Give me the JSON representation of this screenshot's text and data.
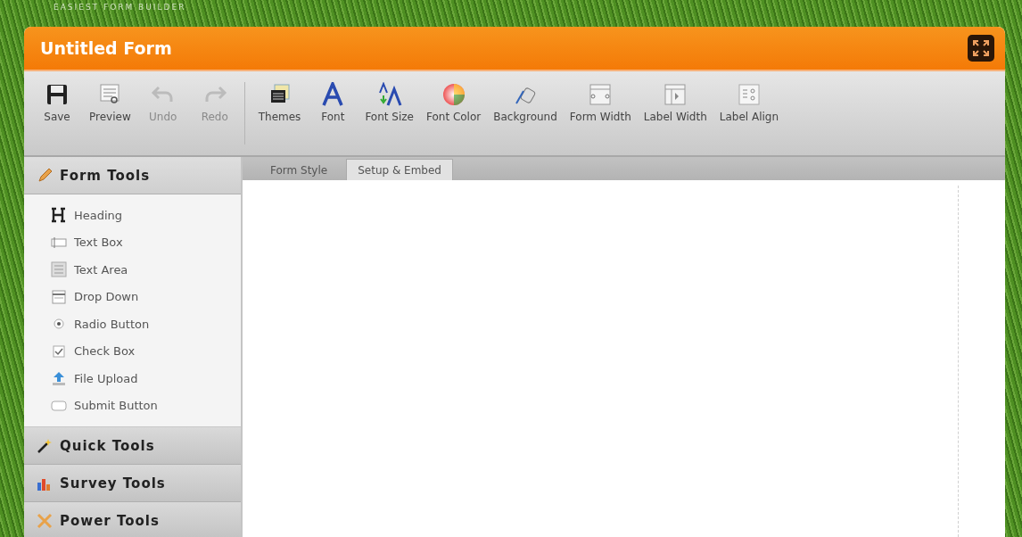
{
  "brand": {
    "tagline": "EASIEST FORM BUILDER"
  },
  "window": {
    "title": "Untitled Form"
  },
  "toolbar": {
    "groups": [
      [
        {
          "label": "Save",
          "disabled": false
        },
        {
          "label": "Preview",
          "disabled": false
        },
        {
          "label": "Undo",
          "disabled": true
        },
        {
          "label": "Redo",
          "disabled": true
        }
      ],
      [
        {
          "label": "Themes",
          "disabled": false
        },
        {
          "label": "Font",
          "disabled": false
        },
        {
          "label": "Font Size",
          "disabled": false
        },
        {
          "label": "Font Color",
          "disabled": false
        },
        {
          "label": "Background",
          "disabled": false
        },
        {
          "label": "Form Width",
          "disabled": false
        },
        {
          "label": "Label Width",
          "disabled": false
        },
        {
          "label": "Label Align",
          "disabled": false
        }
      ]
    ]
  },
  "sidebar": {
    "sections": [
      {
        "title": "Form Tools",
        "expanded": true,
        "items": [
          "Heading",
          "Text Box",
          "Text Area",
          "Drop Down",
          "Radio Button",
          "Check Box",
          "File Upload",
          "Submit Button"
        ]
      },
      {
        "title": "Quick Tools",
        "expanded": false
      },
      {
        "title": "Survey Tools",
        "expanded": false
      },
      {
        "title": "Power Tools",
        "expanded": false
      }
    ]
  },
  "tabs": [
    {
      "label": "Form Style",
      "selected": false
    },
    {
      "label": "Setup & Embed",
      "selected": true
    }
  ]
}
